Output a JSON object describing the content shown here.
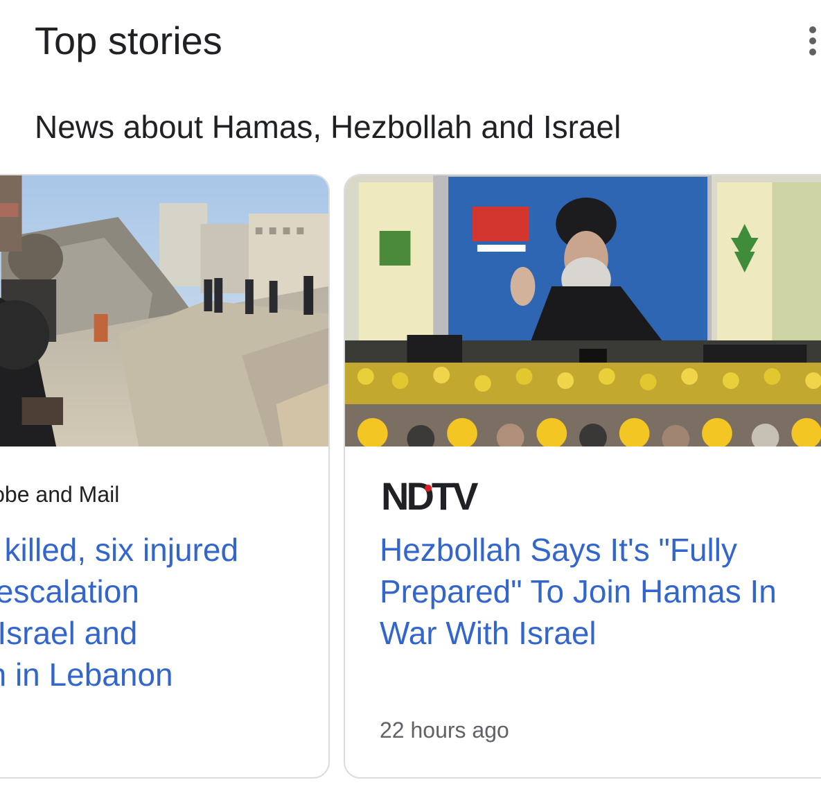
{
  "header": {
    "title": "Top stories",
    "more_icon": "more-vert-icon"
  },
  "topic": {
    "heading": "News about Hamas, Hezbollah and Israel"
  },
  "cards": [
    {
      "source": "lobe and Mail",
      "headline": "st killed, six injured\ny escalation\nn Israel and\nah in Lebanon",
      "time": ""
    },
    {
      "source_logo": "NDTV",
      "headline": "Hezbollah Says It's \"Fully\nPrepared\" To Join Hamas In\nWar With Israel",
      "time": "22 hours ago"
    }
  ],
  "colors": {
    "headline": "#3366cc",
    "text": "#202124",
    "muted": "#5f6368",
    "border": "#dadce0",
    "ndtv_red": "#e31b23"
  }
}
